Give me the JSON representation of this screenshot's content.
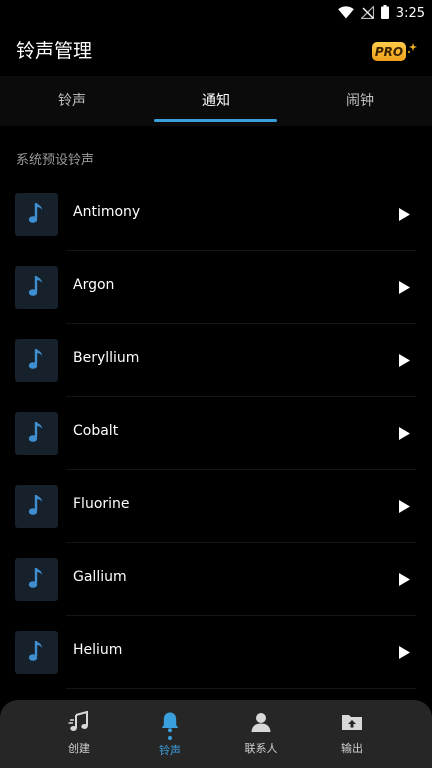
{
  "status_bar": {
    "time": "3:25"
  },
  "app_bar": {
    "title": "铃声管理",
    "pro_label": "PRO"
  },
  "tabs": [
    {
      "label": "铃声",
      "active": false
    },
    {
      "label": "通知",
      "active": true
    },
    {
      "label": "闹钟",
      "active": false
    }
  ],
  "section": {
    "title": "系统预设铃声"
  },
  "ringtones": [
    {
      "name": "Antimony"
    },
    {
      "name": "Argon"
    },
    {
      "name": "Beryllium"
    },
    {
      "name": "Cobalt"
    },
    {
      "name": "Fluorine"
    },
    {
      "name": "Gallium"
    },
    {
      "name": "Helium"
    }
  ],
  "bottom_nav": {
    "items": [
      {
        "label": "创建",
        "icon": "music-note-icon",
        "active": false
      },
      {
        "label": "铃声",
        "icon": "bell-icon",
        "active": true
      },
      {
        "label": "联系人",
        "icon": "person-icon",
        "active": false
      },
      {
        "label": "输出",
        "icon": "folder-upload-icon",
        "active": false
      }
    ]
  },
  "colors": {
    "accent": "#3aa0dd",
    "background": "#000000",
    "nav_background": "#262626",
    "thumb_background": "#16212b",
    "pro_gold": "#f5b324"
  }
}
